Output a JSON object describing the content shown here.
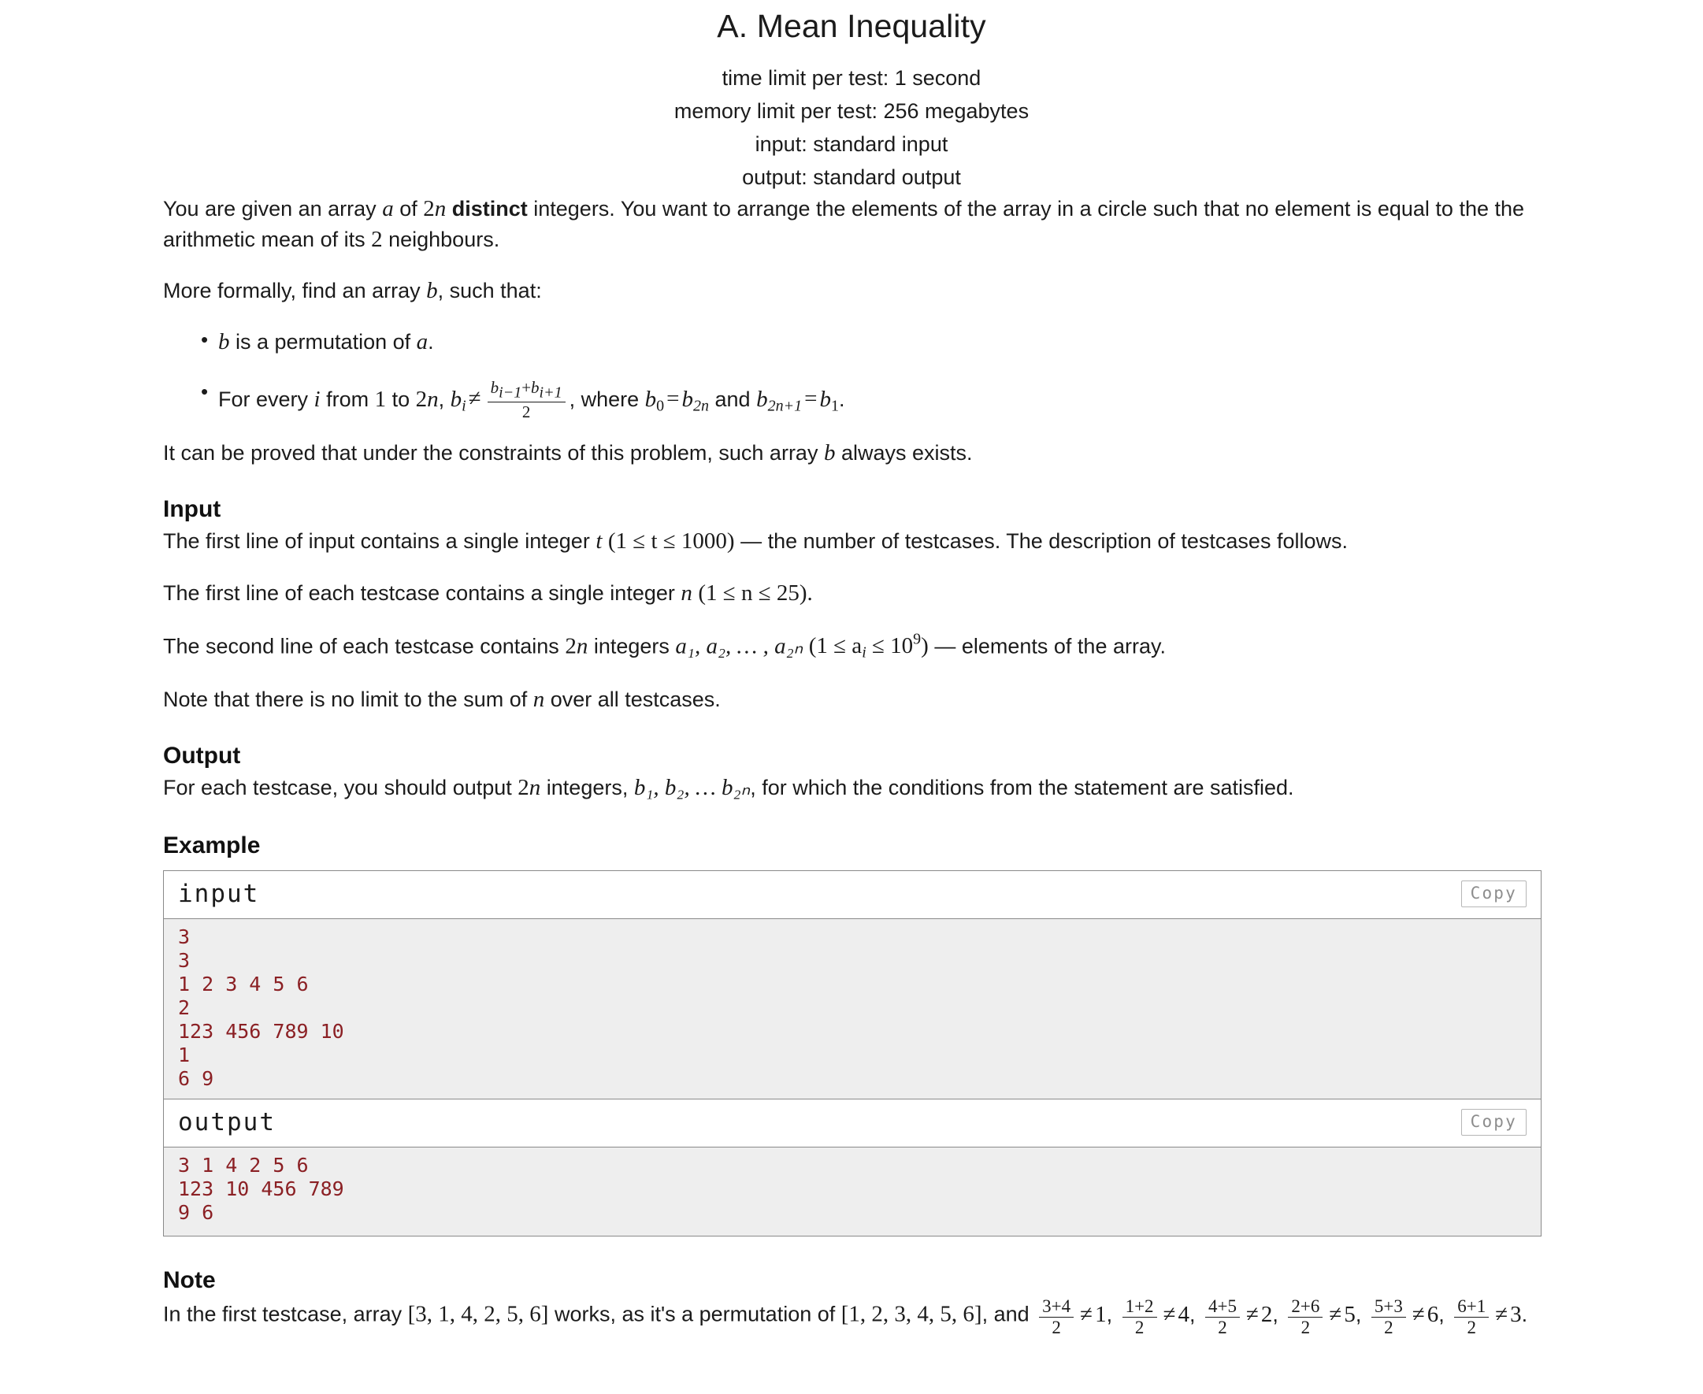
{
  "header": {
    "title": "A. Mean Inequality",
    "time_limit": "time limit per test: 1 second",
    "memory_limit": "memory limit per test: 256 megabytes",
    "input_spec": "input: standard input",
    "output_spec": "output: standard output"
  },
  "statement": {
    "p1_a": "You are given an array ",
    "p1_var_a": "a",
    "p1_b": " of ",
    "p1_2n_num": "2",
    "p1_2n_var": "n",
    "p1_distinct": "distinct",
    "p1_c": " integers. You want to arrange the elements of the array in a circle such that no element is equal to the the arithmetic mean of its ",
    "p1_two": "2",
    "p1_d": " neighbours.",
    "p2_a": "More formally, find an array ",
    "p2_var_b": "b",
    "p2_b": ", such that:",
    "bullet1_var_b": "b",
    "bullet1_a": " is a permutation of ",
    "bullet1_var_a": "a",
    "bullet1_b": ".",
    "bullet2_a": "For every ",
    "bullet2_var_i": "i",
    "bullet2_b": " from ",
    "bullet2_one": "1",
    "bullet2_c": " to ",
    "bullet2_2n_num": "2",
    "bullet2_2n_var": "n",
    "bullet2_comma": ", ",
    "bullet2_bi_var": "b",
    "bullet2_bi_sub": "i",
    "bullet2_neq": "≠",
    "frac_num_b1": "b",
    "frac_num_sub1": "i−1",
    "frac_num_plus": "+",
    "frac_num_b2": "b",
    "frac_num_sub2": "i+1",
    "frac_den": "2",
    "bullet2_d": ", where ",
    "bullet2_b0_var": "b",
    "bullet2_b0_sub": "0",
    "bullet2_eq1": "=",
    "bullet2_b2n_var": "b",
    "bullet2_b2n_sub": "2n",
    "bullet2_e": " and ",
    "bullet2_b2n1_var": "b",
    "bullet2_b2n1_sub": "2n+1",
    "bullet2_eq2": "=",
    "bullet2_b1_var": "b",
    "bullet2_b1_sub": "1",
    "bullet2_f": ".",
    "p3_a": "It can be proved that under the constraints of this problem, such array ",
    "p3_var_b": "b",
    "p3_b": " always exists."
  },
  "input_section": {
    "heading": "Input",
    "line1_a": "The first line of input contains a single integer ",
    "line1_var_t": "t",
    "line1_paren": "(1 ≤ t ≤ 1000)",
    "line1_b": " — the number of testcases. The description of testcases follows.",
    "line2_a": "The first line of each testcase contains a single integer ",
    "line2_var_n": "n",
    "line2_paren": "(1 ≤ n ≤ 25).",
    "line3_a": "The second line of each testcase contains ",
    "line3_2n_num": "2",
    "line3_2n_var": "n",
    "line3_b": " integers ",
    "line3_list": "a₁, a₂, … , a₂ₙ",
    "line3_paren_open": "(1 ≤ a",
    "line3_paren_sub": "i",
    "line3_paren_mid": " ≤ 10",
    "line3_paren_sup": "9",
    "line3_paren_close": ")",
    "line3_c": " — elements of the array.",
    "line4_a": "Note that there is no limit to the sum of ",
    "line4_var_n": "n",
    "line4_b": " over all testcases."
  },
  "output_section": {
    "heading": "Output",
    "line1_a": "For each testcase, you should output ",
    "line1_2n_num": "2",
    "line1_2n_var": "n",
    "line1_b": " integers, ",
    "line1_list": "b₁, b₂, … b₂ₙ",
    "line1_c": ", for which the conditions from the statement are satisfied."
  },
  "example_section": {
    "heading": "Example",
    "input_label": "input",
    "output_label": "output",
    "copy_label": "Copy",
    "input_text": "3\n3\n1 2 3 4 5 6\n2\n123 456 789 10\n1\n6 9",
    "output_text": "3 1 4 2 5 6\n123 10 456 789\n9 6"
  },
  "note_section": {
    "heading": "Note",
    "line_a": "In the first testcase, array ",
    "array_b": "[3, 1, 4, 2, 5, 6]",
    "line_b": " works, as it's a permutation of ",
    "array_a": "[1, 2, 3, 4, 5, 6]",
    "line_c": ", and ",
    "fractions": [
      {
        "num": "3+4",
        "den": "2",
        "rel": "≠",
        "rhs": "1",
        "sep": ", "
      },
      {
        "num": "1+2",
        "den": "2",
        "rel": "≠",
        "rhs": "4",
        "sep": ", "
      },
      {
        "num": "4+5",
        "den": "2",
        "rel": "≠",
        "rhs": "2",
        "sep": ", "
      },
      {
        "num": "2+6",
        "den": "2",
        "rel": "≠",
        "rhs": "5",
        "sep": ", "
      },
      {
        "num": "5+3",
        "den": "2",
        "rel": "≠",
        "rhs": "6",
        "sep": ", "
      },
      {
        "num": "6+1",
        "den": "2",
        "rel": "≠",
        "rhs": "3",
        "sep": "."
      }
    ]
  },
  "colors": {
    "code_text": "#8b2024",
    "code_bg": "#eeeeee",
    "border": "#8a8a8a",
    "copy_text": "#8d8d8d",
    "body_text": "#1b1b1b"
  }
}
